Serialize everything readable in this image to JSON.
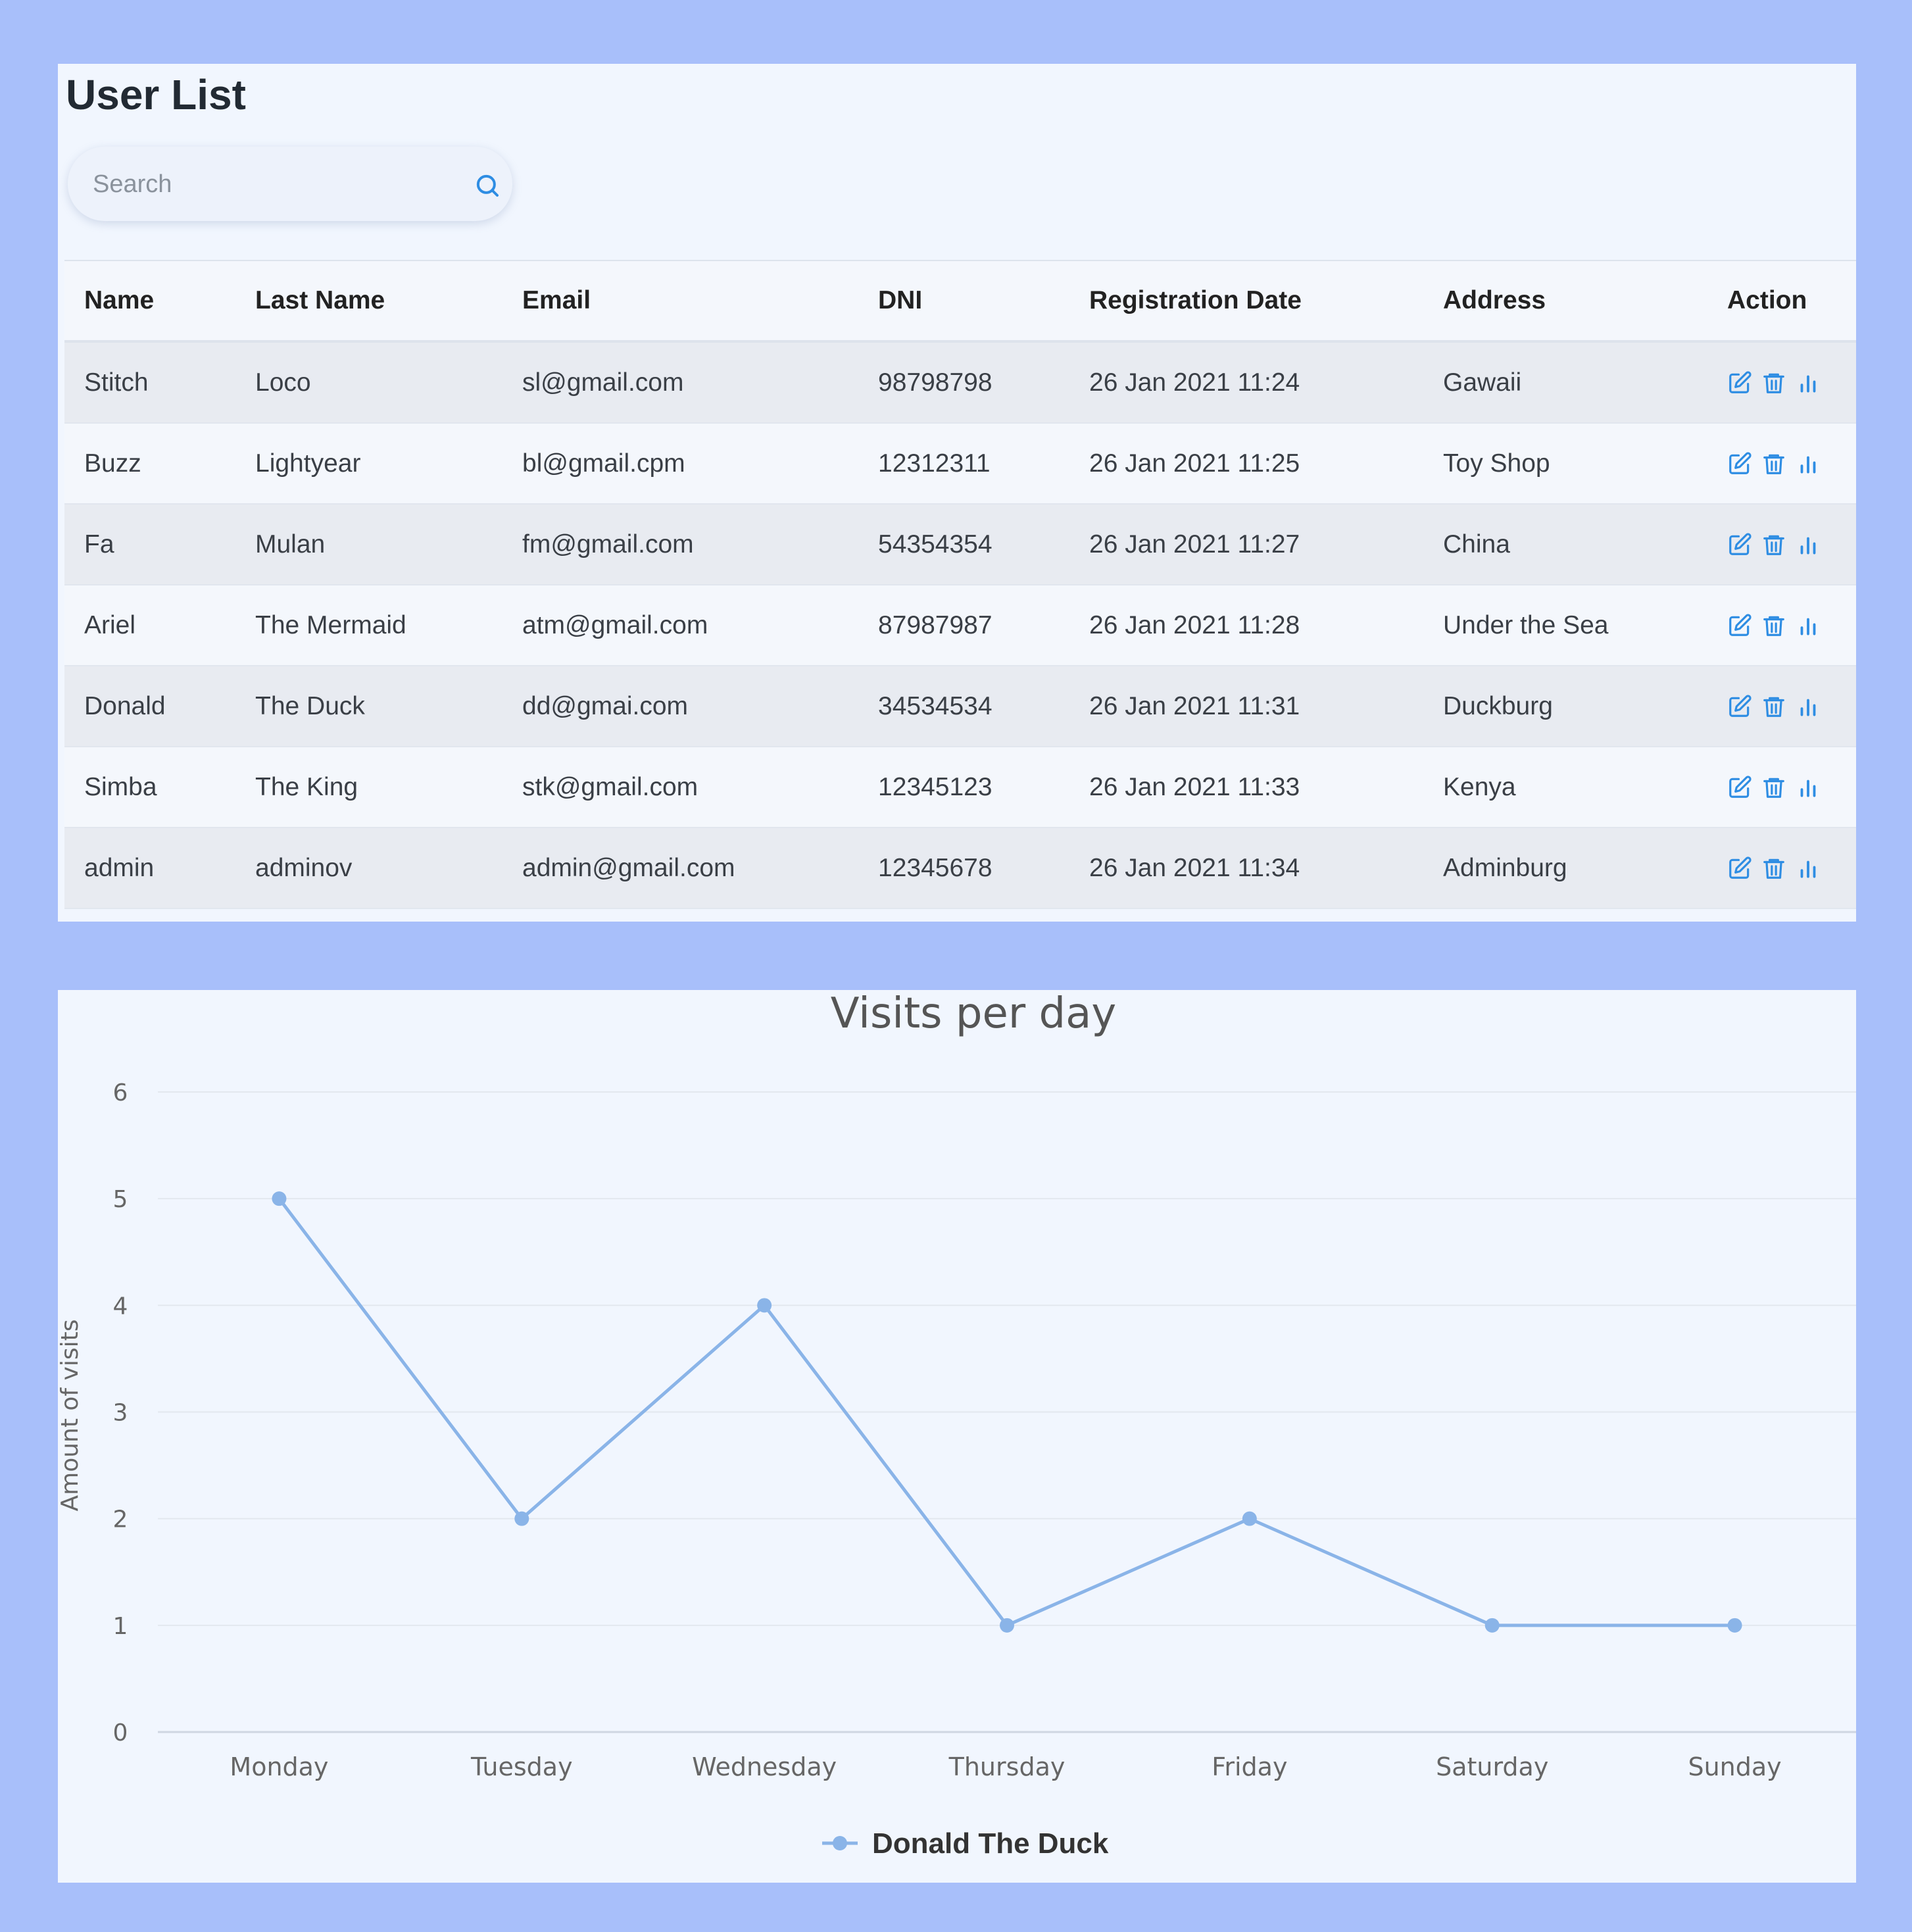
{
  "page": {
    "title": "User List"
  },
  "search": {
    "placeholder": "Search",
    "icon": "search-icon"
  },
  "table": {
    "headers": [
      "Name",
      "Last Name",
      "Email",
      "DNI",
      "Registration Date",
      "Address",
      "Action"
    ],
    "rows": [
      [
        "Stitch",
        "Loco",
        "sl@gmail.com",
        "98798798",
        "26 Jan 2021 11:24",
        "Gawaii"
      ],
      [
        "Buzz",
        "Lightyear",
        "bl@gmail.cpm",
        "12312311",
        "26 Jan 2021 11:25",
        "Toy Shop"
      ],
      [
        "Fa",
        "Mulan",
        "fm@gmail.com",
        "54354354",
        "26 Jan 2021 11:27",
        "China"
      ],
      [
        "Ariel",
        "The Mermaid",
        "atm@gmail.com",
        "87987987",
        "26 Jan 2021 11:28",
        "Under the Sea"
      ],
      [
        "Donald",
        "The Duck",
        "dd@gmai.com",
        "34534534",
        "26 Jan 2021 11:31",
        "Duckburg"
      ],
      [
        "Simba",
        "The King",
        "stk@gmail.com",
        "12345123",
        "26 Jan 2021 11:33",
        "Kenya"
      ],
      [
        "admin",
        "adminov",
        "admin@gmail.com",
        "12345678",
        "26 Jan 2021 11:34",
        "Adminburg"
      ]
    ],
    "action_icons": [
      "edit-icon",
      "trash-icon",
      "bar-chart-icon"
    ]
  },
  "colors": {
    "accent": "#2e8de3",
    "line": "#8ab4e8",
    "page_bg": "#a8bffa",
    "panel_bg": "#f1f6fe"
  },
  "chart_data": {
    "type": "line",
    "title": "Visits per day",
    "ylabel": "Amount of visits",
    "xlabel": "",
    "categories": [
      "Monday",
      "Tuesday",
      "Wednesday",
      "Thursday",
      "Friday",
      "Saturday",
      "Sunday"
    ],
    "series": [
      {
        "name": "Donald The Duck",
        "values": [
          5,
          2,
          4,
          1,
          2,
          1,
          1
        ]
      }
    ],
    "ylim": [
      0,
      6
    ],
    "yticks": [
      "0",
      "1",
      "2",
      "3",
      "4",
      "5",
      "6"
    ],
    "grid": true,
    "legend": "bottom-center"
  }
}
